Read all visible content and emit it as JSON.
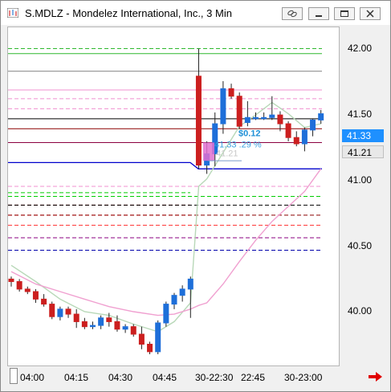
{
  "window": {
    "title": "S.MDLZ - Mondelez International, Inc., 3 Min",
    "buttons": [
      "link-icon",
      "minimize-icon",
      "maximize-icon",
      "close-icon"
    ]
  },
  "price_axis": {
    "ticks": [
      "42.00",
      "41.50",
      "41.00",
      "40.50",
      "40.00"
    ],
    "last_price_tag": "41.33",
    "open_price_tag": "41.21"
  },
  "time_axis": {
    "ticks": [
      "04:00",
      "04:15",
      "04:30",
      "04:45",
      "30-22:30",
      "22:45",
      "30-23:00"
    ]
  },
  "annotations": {
    "change_label": "$0.12",
    "pct_label": "41.33 .29 %",
    "faded_price": "41.21"
  },
  "colors": {
    "up_candle": "#1e6fd9",
    "down_candle": "#cc1f1f",
    "last_price_tag": "#1e90ff",
    "ema_fast": "#b8d8b8",
    "ema_slow": "#f0a0d0",
    "nav_arrow": "#e00000"
  },
  "chart_data": {
    "type": "candlestick",
    "ylim": [
      39.55,
      42.25
    ],
    "x": [
      "04:00",
      "04:15",
      "04:30",
      "04:45",
      "30-22:30",
      "22:45",
      "30-23:00"
    ],
    "candles": [
      {
        "o": 40.24,
        "h": 40.26,
        "l": 40.18,
        "c": 40.22
      },
      {
        "o": 40.22,
        "h": 40.24,
        "l": 40.14,
        "c": 40.16
      },
      {
        "o": 40.16,
        "h": 40.18,
        "l": 40.12,
        "c": 40.14
      },
      {
        "o": 40.14,
        "h": 40.16,
        "l": 40.05,
        "c": 40.08
      },
      {
        "o": 40.08,
        "h": 40.12,
        "l": 40.02,
        "c": 40.04
      },
      {
        "o": 40.04,
        "h": 40.06,
        "l": 39.92,
        "c": 39.94
      },
      {
        "o": 39.94,
        "h": 40.02,
        "l": 39.91,
        "c": 40.0
      },
      {
        "o": 40.0,
        "h": 40.02,
        "l": 39.93,
        "c": 39.96
      },
      {
        "o": 39.96,
        "h": 40.0,
        "l": 39.85,
        "c": 39.9
      },
      {
        "o": 39.9,
        "h": 39.93,
        "l": 39.84,
        "c": 39.86
      },
      {
        "o": 39.86,
        "h": 39.9,
        "l": 39.84,
        "c": 39.87
      },
      {
        "o": 39.87,
        "h": 39.95,
        "l": 39.84,
        "c": 39.93
      },
      {
        "o": 39.93,
        "h": 39.97,
        "l": 39.86,
        "c": 39.9
      },
      {
        "o": 39.9,
        "h": 39.95,
        "l": 39.82,
        "c": 39.84
      },
      {
        "o": 39.84,
        "h": 39.88,
        "l": 39.81,
        "c": 39.86
      },
      {
        "o": 39.86,
        "h": 39.88,
        "l": 39.78,
        "c": 39.8
      },
      {
        "o": 39.8,
        "h": 39.86,
        "l": 39.68,
        "c": 39.72
      },
      {
        "o": 39.72,
        "h": 39.74,
        "l": 39.64,
        "c": 39.66
      },
      {
        "o": 39.66,
        "h": 39.91,
        "l": 39.64,
        "c": 39.89
      },
      {
        "o": 39.89,
        "h": 40.06,
        "l": 39.86,
        "c": 40.04
      },
      {
        "o": 40.04,
        "h": 40.13,
        "l": 40.0,
        "c": 40.11
      },
      {
        "o": 40.11,
        "h": 40.19,
        "l": 40.06,
        "c": 40.16
      },
      {
        "o": 40.16,
        "h": 40.26,
        "l": 39.93,
        "c": 40.24
      },
      {
        "o": 41.86,
        "h": 42.08,
        "l": 41.12,
        "c": 41.15
      },
      {
        "o": 41.15,
        "h": 41.34,
        "l": 41.08,
        "c": 41.24
      },
      {
        "o": 41.24,
        "h": 41.57,
        "l": 41.14,
        "c": 41.48
      },
      {
        "o": 41.48,
        "h": 41.82,
        "l": 41.4,
        "c": 41.76
      },
      {
        "o": 41.76,
        "h": 41.8,
        "l": 41.68,
        "c": 41.7
      },
      {
        "o": 41.7,
        "h": 41.73,
        "l": 41.44,
        "c": 41.46
      },
      {
        "o": 41.49,
        "h": 41.66,
        "l": 41.46,
        "c": 41.53
      },
      {
        "o": 41.53,
        "h": 41.57,
        "l": 41.51,
        "c": 41.53
      },
      {
        "o": 41.53,
        "h": 41.57,
        "l": 41.51,
        "c": 41.53
      },
      {
        "o": 41.53,
        "h": 41.7,
        "l": 41.51,
        "c": 41.55
      },
      {
        "o": 41.55,
        "h": 41.58,
        "l": 41.42,
        "c": 41.48
      },
      {
        "o": 41.48,
        "h": 41.5,
        "l": 41.34,
        "c": 41.37
      },
      {
        "o": 41.37,
        "h": 41.42,
        "l": 41.3,
        "c": 41.32
      },
      {
        "o": 41.32,
        "h": 41.45,
        "l": 41.26,
        "c": 41.43
      },
      {
        "o": 41.43,
        "h": 41.52,
        "l": 41.38,
        "c": 41.51
      },
      {
        "o": 41.51,
        "h": 41.59,
        "l": 41.48,
        "c": 41.56
      }
    ],
    "ema_fast": [
      [
        0,
        40.35
      ],
      [
        3,
        40.22
      ],
      [
        6,
        40.08
      ],
      [
        9,
        39.98
      ],
      [
        12,
        39.95
      ],
      [
        15,
        39.88
      ],
      [
        18,
        39.82
      ],
      [
        20,
        39.9
      ],
      [
        22,
        40.05
      ],
      [
        23,
        40.98
      ],
      [
        24,
        41.04
      ],
      [
        26,
        41.25
      ],
      [
        28,
        41.46
      ],
      [
        30,
        41.55
      ],
      [
        32,
        41.65
      ],
      [
        34,
        41.56
      ],
      [
        36,
        41.45
      ],
      [
        38,
        41.48
      ]
    ],
    "ema_slow": [
      [
        0,
        40.3
      ],
      [
        3,
        40.2
      ],
      [
        6,
        40.14
      ],
      [
        9,
        40.08
      ],
      [
        12,
        40.02
      ],
      [
        15,
        39.98
      ],
      [
        18,
        39.95
      ],
      [
        20,
        39.96
      ],
      [
        22,
        40.0
      ],
      [
        23,
        40.03
      ],
      [
        24,
        40.05
      ],
      [
        26,
        40.2
      ],
      [
        28,
        40.38
      ],
      [
        30,
        40.55
      ],
      [
        32,
        40.7
      ],
      [
        34,
        40.82
      ],
      [
        36,
        40.94
      ],
      [
        38,
        41.12
      ]
    ],
    "levels_full": [
      {
        "y": 42.08,
        "color": "#2eb82e",
        "dash": "5,3"
      },
      {
        "y": 42.04,
        "color": "#2eb82e",
        "dash": ""
      },
      {
        "y": 41.9,
        "color": "#888888",
        "dash": ""
      },
      {
        "y": 41.75,
        "color": "#f090d0",
        "dash": ""
      },
      {
        "y": 41.68,
        "color": "#f090d0",
        "dash": "5,3"
      },
      {
        "y": 41.6,
        "color": "#f090d0",
        "dash": "5,3"
      },
      {
        "y": 41.52,
        "color": "#000000",
        "dash": ""
      },
      {
        "y": 41.44,
        "color": "#8b0000",
        "dash": ""
      },
      {
        "y": 41.33,
        "color": "#8b0040",
        "dash": ""
      }
    ],
    "level_blue": {
      "y_left": 41.17,
      "y_right": 41.12,
      "color": "#0000cc"
    },
    "levels_dashed": [
      {
        "y": 40.98,
        "color": "#f090d0"
      },
      {
        "y": 40.9,
        "color": "#00cc00"
      },
      {
        "y": 40.83,
        "color": "#000000"
      },
      {
        "y": 40.75,
        "color": "#8b0000"
      },
      {
        "y": 40.67,
        "color": "#ff3030"
      },
      {
        "y": 40.57,
        "color": "#8b0080"
      },
      {
        "y": 40.47,
        "color": "#0000aa"
      }
    ],
    "levels_left_extra": [
      {
        "y": 40.93,
        "color": "#00cc00"
      },
      {
        "y": 40.83,
        "color": "#8b0000"
      },
      {
        "y": 40.75,
        "color": "#ff3030"
      }
    ]
  }
}
